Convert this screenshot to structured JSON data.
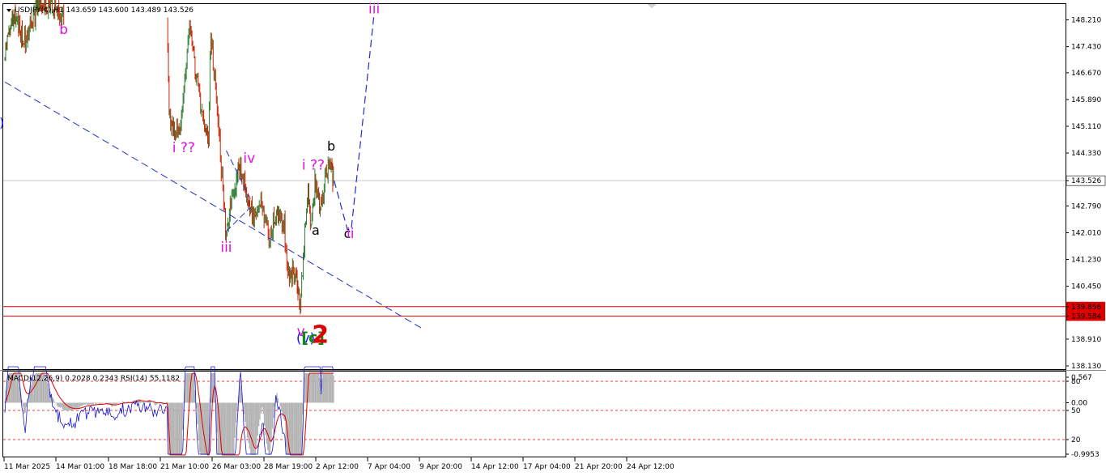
{
  "header": {
    "symbol_line": "USDJPY(€),H1  143.659 143.600 143.489 143.526"
  },
  "indicator_header": "MACD(12,26,9) 0.2028 0.2343   RSI(14) 55.1182",
  "colors": {
    "up_candle": "#2e7d32",
    "down_candle": "#cc2200",
    "wave_magenta": "#e010e0",
    "wave_blue": "#1a1aff",
    "wave_green": "#118811",
    "wave_red": "#e00000",
    "trend_line": "#1f2fc8",
    "support_line": "#e00000",
    "macd_hist": "#b4b4b4",
    "macd_signal": "#e00000",
    "rsi_line": "#1a1acc"
  },
  "chart_data": [
    {
      "type": "candlestick",
      "symbol": "USDJPY",
      "timeframe": "H1",
      "ylim": [
        138.13,
        148.6
      ],
      "y_ticks": [
        "148.210",
        "147.430",
        "146.670",
        "145.890",
        "145.110",
        "144.330",
        "143.526",
        "142.790",
        "142.010",
        "141.230",
        "140.450",
        "139.856",
        "139.584",
        "138.910",
        "138.130"
      ],
      "x_ticks": [
        "11 Mar 2025",
        "14 Mar 01:00",
        "18 Mar 18:00",
        "21 Mar 10:00",
        "26 Mar 03:00",
        "28 Mar 19:00",
        "2 Apr 12:00",
        "7 Apr 04:00",
        "9 Apr 20:00",
        "14 Apr 12:00",
        "17 Apr 04:00",
        "21 Apr 20:00",
        "24 Apr 12:00"
      ],
      "last_price": 143.526,
      "last_price_label": "143.526",
      "horizontal_levels": [
        {
          "price": 139.856,
          "label": "139.856"
        },
        {
          "price": 139.584,
          "label": "139.584"
        }
      ],
      "price_path_anchors": [
        {
          "date": "2025-03-11 01:00",
          "price": 147.1
        },
        {
          "date": "2025-03-12 10:00",
          "price": 148.3
        },
        {
          "date": "2025-03-13 20:00",
          "price": 147.6
        },
        {
          "date": "2025-03-16 10:00",
          "price": 148.8
        },
        {
          "date": "2025-03-18 00:00",
          "price": 148.5
        },
        {
          "date": "2025-03-19 12:00",
          "price": 148.3
        },
        {
          "date": "2025-04-03 03:00",
          "price": 148.5
        },
        {
          "date": "2025-04-03 10:00",
          "price": 145.3
        },
        {
          "date": "2025-04-04 20:00",
          "price": 144.8
        },
        {
          "date": "2025-04-06 08:00",
          "price": 147.9
        },
        {
          "date": "2025-04-08 00:00",
          "price": 145.6
        },
        {
          "date": "2025-04-09 00:00",
          "price": 144.8
        },
        {
          "date": "2025-04-09 08:00",
          "price": 147.9
        },
        {
          "date": "2025-04-10 14:00",
          "price": 144.6
        },
        {
          "date": "2025-04-11 10:00",
          "price": 142.1
        },
        {
          "date": "2025-04-13 10:00",
          "price": 144.0
        },
        {
          "date": "2025-04-15 10:00",
          "price": 142.4
        },
        {
          "date": "2025-04-16 13:00",
          "price": 142.9
        },
        {
          "date": "2025-04-17 14:00",
          "price": 141.9
        },
        {
          "date": "2025-04-18 13:00",
          "price": 142.6
        },
        {
          "date": "2025-04-19 18:00",
          "price": 142.2
        },
        {
          "date": "2025-04-20 06:00",
          "price": 140.8
        },
        {
          "date": "2025-04-21 06:00",
          "price": 140.9
        },
        {
          "date": "2025-04-22 00:00",
          "price": 140.0
        },
        {
          "date": "2025-04-22 13:00",
          "price": 141.6
        },
        {
          "date": "2025-04-23 03:00",
          "price": 143.3
        },
        {
          "date": "2025-04-23 13:00",
          "price": 142.1
        },
        {
          "date": "2025-04-24 02:00",
          "price": 143.5
        },
        {
          "date": "2025-04-24 20:00",
          "price": 142.6
        },
        {
          "date": "2025-04-25 15:00",
          "price": 143.6
        },
        {
          "date": "2025-04-26 07:00",
          "price": 144.0
        },
        {
          "date": "2025-04-26 17:00",
          "price": 143.526
        }
      ],
      "projection_path": [
        {
          "date": "2025-04-26 17:00",
          "price": 143.526
        },
        {
          "date": "2025-04-28 14:00",
          "price": 142.1
        },
        {
          "date": "2025-04-29 03:00",
          "price": 142.1
        },
        {
          "date": "2025-05-02 09:00",
          "price": 148.4
        }
      ],
      "trend_line": [
        {
          "date": "2025-03-11 01:00",
          "price": 146.4
        },
        {
          "date": "2025-05-09 08:00",
          "price": 139.2
        }
      ],
      "triangle_lines": [
        [
          {
            "date": "2025-04-11 10:00",
            "price": 144.4
          },
          {
            "date": "2025-04-14 20:00",
            "price": 143.0
          }
        ],
        [
          {
            "date": "2025-04-11 10:00",
            "price": 142.05
          },
          {
            "date": "2025-04-14 20:00",
            "price": 142.75
          }
        ]
      ],
      "wave_labels": [
        {
          "text": "b",
          "color": "magenta",
          "date": "2025-03-19 09:00",
          "price": 147.8
        },
        {
          "text": "i ??",
          "color": "magenta",
          "date": "2025-04-05 09:00",
          "price": 144.35
        },
        {
          "text": "iv",
          "color": "magenta",
          "date": "2025-04-14 16:00",
          "price": 144.05
        },
        {
          "text": "iii",
          "color": "magenta",
          "date": "2025-04-11 10:00",
          "price": 141.45
        },
        {
          "text": "i ??",
          "color": "magenta",
          "date": "2025-04-23 18:00",
          "price": 143.85
        },
        {
          "text": "b",
          "color": "black",
          "date": "2025-04-26 07:00",
          "price": 144.4
        },
        {
          "text": "a",
          "color": "black",
          "date": "2025-04-24 02:00",
          "price": 141.95
        },
        {
          "text": "c",
          "color": "black",
          "date": "2025-04-28 14:00",
          "price": 141.85
        },
        {
          "text": "ii",
          "color": "magenta",
          "date": "2025-04-29 00:00",
          "price": 141.85
        },
        {
          "text": "iii",
          "color": "magenta",
          "date": "2025-05-02 09:00",
          "price": 148.4
        },
        {
          "text": "v",
          "color": "magenta",
          "date": "2025-04-22 00:00",
          "price": 139.0
        },
        {
          "text": "(v)",
          "color": "blue",
          "date": "2025-04-22 16:00",
          "price": 138.8
        },
        {
          "text": "[c]",
          "color": "green",
          "date": "2025-04-23 17:00",
          "price": 138.8
        },
        {
          "text": "2",
          "color": "red",
          "date": "2025-04-24 18:00",
          "price": 138.8
        }
      ]
    },
    {
      "type": "indicator",
      "name": "MACD(12,26,9) + RSI(14)",
      "macd_main": 0.2028,
      "macd_signal": 0.2343,
      "rsi": 55.1182,
      "y_ticks": [
        "0.567",
        "80",
        "0.00",
        "50",
        "20",
        "-0.9953"
      ],
      "rsi_levels": [
        80,
        50,
        20
      ]
    }
  ]
}
